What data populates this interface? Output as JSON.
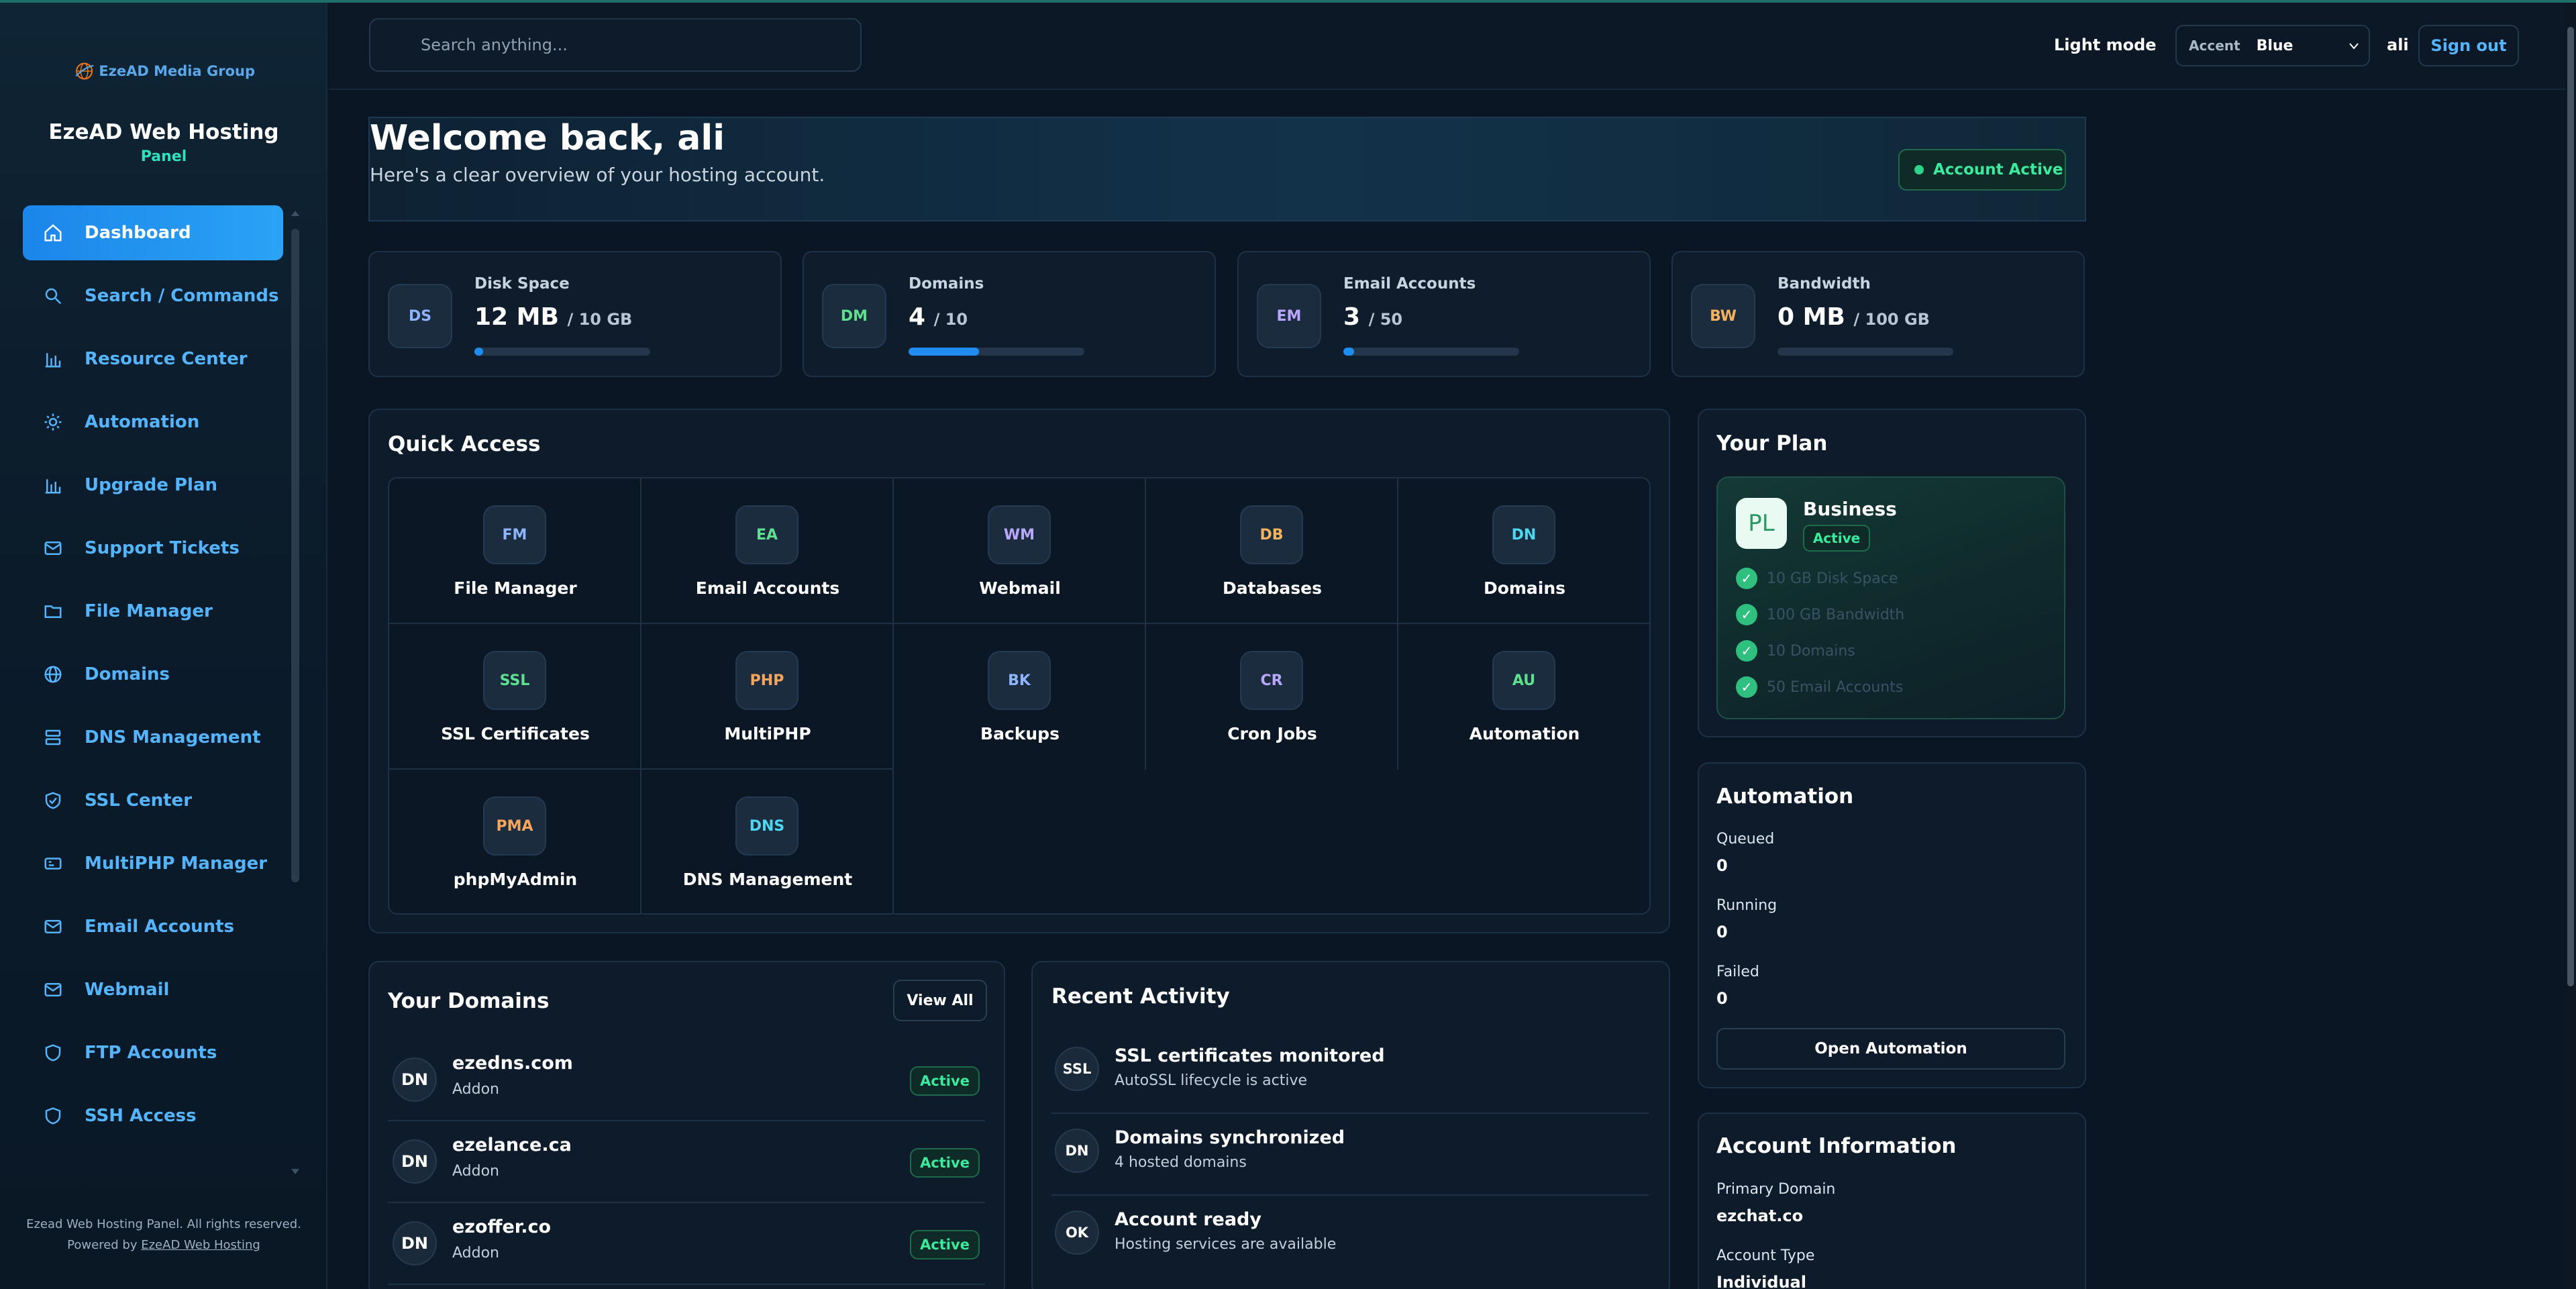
{
  "sidebar": {
    "logo_text": "EzeAD Media Group",
    "brand": "EzeAD Web Hosting",
    "brand_sub": "Panel",
    "items": [
      {
        "label": "Dashboard",
        "icon": "home-icon",
        "active": true
      },
      {
        "label": "Search / Commands",
        "icon": "search-icon"
      },
      {
        "label": "Resource Center",
        "icon": "bar-chart-icon"
      },
      {
        "label": "Automation",
        "icon": "sun-icon"
      },
      {
        "label": "Upgrade Plan",
        "icon": "bar-chart-icon"
      },
      {
        "label": "Support Tickets",
        "icon": "mail-icon"
      },
      {
        "label": "File Manager",
        "icon": "folder-icon"
      },
      {
        "label": "Domains",
        "icon": "globe-icon"
      },
      {
        "label": "DNS Management",
        "icon": "server-icon"
      },
      {
        "label": "SSL Center",
        "icon": "shield-check-icon"
      },
      {
        "label": "MultiPHP Manager",
        "icon": "php-card-icon"
      },
      {
        "label": "Email Accounts",
        "icon": "mail-icon"
      },
      {
        "label": "Webmail",
        "icon": "mail-icon"
      },
      {
        "label": "FTP Accounts",
        "icon": "shield-icon"
      },
      {
        "label": "SSH Access",
        "icon": "shield-icon"
      }
    ],
    "footer_line1": "Ezead Web Hosting Panel. All rights reserved.",
    "footer_powered": "Powered by",
    "footer_link": "EzeAD Web Hosting"
  },
  "topbar": {
    "search_placeholder": "Search anything...",
    "light_mode": "Light mode",
    "accent_label": "Accent",
    "accent_value": "Blue",
    "username": "ali",
    "sign_out": "Sign out"
  },
  "welcome": {
    "title": "Welcome back, ali",
    "subtitle": "Here's a clear overview of your hosting account.",
    "status": "Account Active"
  },
  "stats": [
    {
      "abbr": "DS",
      "title": "Disk Space",
      "value": "12 MB",
      "limit": "/ 10 GB",
      "usage": 0.0012,
      "abbr_color": "#8fb4ff"
    },
    {
      "abbr": "DM",
      "title": "Domains",
      "value": "4",
      "limit": "/ 10",
      "usage": 0.4,
      "abbr_color": "#5ee08e"
    },
    {
      "abbr": "EM",
      "title": "Email Accounts",
      "value": "3",
      "limit": "/ 50",
      "usage": 0.06,
      "abbr_color": "#b9a7ff"
    },
    {
      "abbr": "BW",
      "title": "Bandwidth",
      "value": "0 MB",
      "limit": "/ 100 GB",
      "usage": 0,
      "abbr_color": "#f5b25c"
    }
  ],
  "quick_access": {
    "title": "Quick Access",
    "items": [
      {
        "abbr": "FM",
        "label": "File Manager",
        "color": "#8fb4ff"
      },
      {
        "abbr": "EA",
        "label": "Email Accounts",
        "color": "#5ee08e"
      },
      {
        "abbr": "WM",
        "label": "Webmail",
        "color": "#b9a7ff"
      },
      {
        "abbr": "DB",
        "label": "Databases",
        "color": "#f5b25c"
      },
      {
        "abbr": "DN",
        "label": "Domains",
        "color": "#4fd6f0"
      },
      {
        "abbr": "SSL",
        "label": "SSL Certificates",
        "color": "#5ee08e"
      },
      {
        "abbr": "PHP",
        "label": "MultiPHP",
        "color": "#f5a65c"
      },
      {
        "abbr": "BK",
        "label": "Backups",
        "color": "#8fb4ff"
      },
      {
        "abbr": "CR",
        "label": "Cron Jobs",
        "color": "#b9a7ff"
      },
      {
        "abbr": "AU",
        "label": "Automation",
        "color": "#5ee08e"
      },
      {
        "abbr": "PMA",
        "label": "phpMyAdmin",
        "color": "#f5a65c"
      },
      {
        "abbr": "DNS",
        "label": "DNS Management",
        "color": "#4fd6f0"
      }
    ]
  },
  "domains": {
    "title": "Your Domains",
    "view_all": "View All",
    "rows": [
      {
        "abbr": "DN",
        "name": "ezedns.com",
        "type": "Addon",
        "status": "Active"
      },
      {
        "abbr": "DN",
        "name": "ezelance.ca",
        "type": "Addon",
        "status": "Active"
      },
      {
        "abbr": "DN",
        "name": "ezoffer.co",
        "type": "Addon",
        "status": "Active"
      }
    ]
  },
  "activity": {
    "title": "Recent Activity",
    "rows": [
      {
        "abbr": "SSL",
        "title": "SSL certificates monitored",
        "desc": "AutoSSL lifecycle is active"
      },
      {
        "abbr": "DN",
        "title": "Domains synchronized",
        "desc": "4 hosted domains"
      },
      {
        "abbr": "OK",
        "title": "Account ready",
        "desc": "Hosting services are available"
      }
    ]
  },
  "plan": {
    "title": "Your Plan",
    "icon_text": "PL",
    "name": "Business",
    "status": "Active",
    "features": [
      "10 GB Disk Space",
      "100 GB Bandwidth",
      "10 Domains",
      "50 Email Accounts"
    ]
  },
  "automation": {
    "title": "Automation",
    "queued_label": "Queued",
    "queued": "0",
    "running_label": "Running",
    "running": "0",
    "failed_label": "Failed",
    "failed": "0",
    "open_button": "Open Automation"
  },
  "account_info": {
    "title": "Account Information",
    "primary_domain_label": "Primary Domain",
    "primary_domain": "ezchat.co",
    "account_type_label": "Account Type",
    "account_type": "Individual"
  }
}
